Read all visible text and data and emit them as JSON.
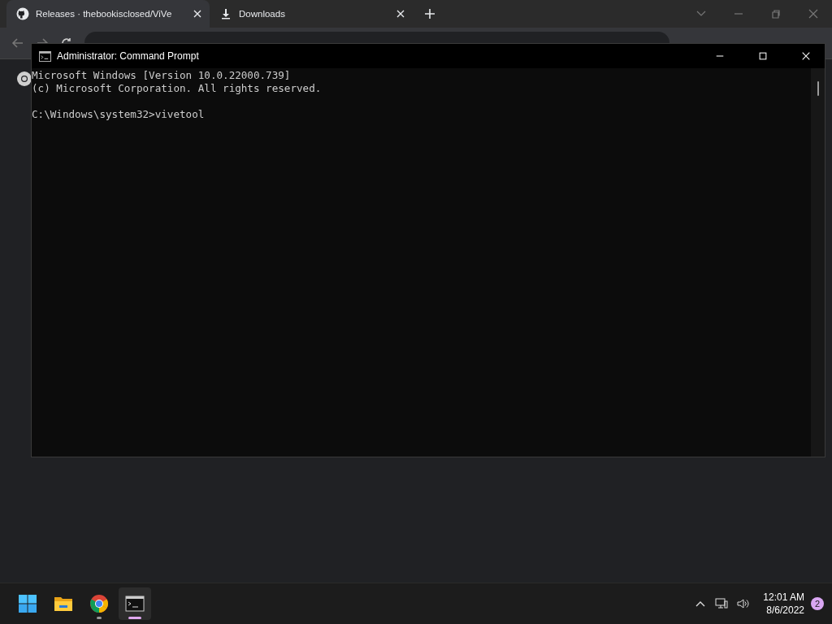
{
  "browser": {
    "tabs": [
      {
        "title": "Releases · thebookisclosed/ViVe",
        "selected": true,
        "kind": "github"
      },
      {
        "title": "Downloads",
        "selected": false,
        "kind": "download"
      }
    ]
  },
  "console": {
    "title": "Administrator: Command Prompt",
    "lines": [
      "Microsoft Windows [Version 10.0.22000.739]",
      "(c) Microsoft Corporation. All rights reserved."
    ],
    "prompt": "C:\\Windows\\system32>vivetool"
  },
  "taskbar": {
    "apps": [
      {
        "kind": "start",
        "selected": false
      },
      {
        "kind": "explorer",
        "selected": false
      },
      {
        "kind": "chrome",
        "selected": false,
        "running": true
      },
      {
        "kind": "terminal",
        "selected": true,
        "running": true
      }
    ],
    "time": "12:01 AM",
    "date": "8/6/2022",
    "notifications": "2"
  }
}
